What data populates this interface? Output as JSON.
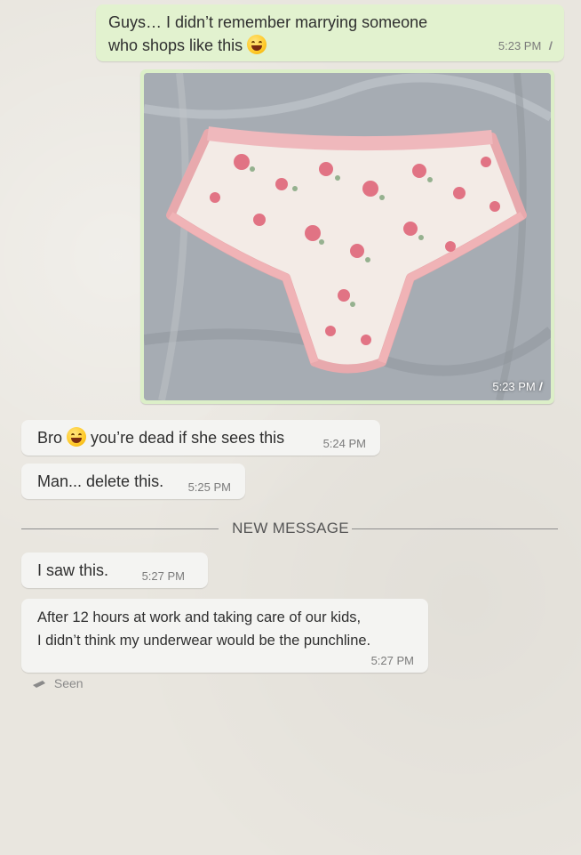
{
  "messages": [
    {
      "id": "m1",
      "dir": "out",
      "line1": "Guys… I didn’t remember marrying someone",
      "line2": "who shops like this",
      "emoji": "grinning-sweat-emoji",
      "time": "5:23 PM"
    },
    {
      "id": "m2",
      "dir": "out",
      "type": "image",
      "image_desc": "floral-underwear-photo",
      "time": "5:23 PM"
    },
    {
      "id": "m3",
      "dir": "in",
      "pre": "Bro",
      "emoji": "laughing-tears-emoji",
      "post": "you’re dead if she sees this",
      "time": "5:24 PM"
    },
    {
      "id": "m4",
      "dir": "in",
      "text": "Man... delete this.",
      "time": "5:25 PM"
    },
    {
      "id": "m5",
      "dir": "in",
      "text": "I saw this.",
      "time": "5:27 PM"
    },
    {
      "id": "m6",
      "dir": "in",
      "line1": "After 12 hours at work and taking care of our kids,",
      "line2": "I didn’t think my underwear would be the punchline.",
      "time": "5:27 PM"
    }
  ],
  "divider": {
    "label": "NEW MESSAGE"
  },
  "status": {
    "seen": "Seen",
    "icon": "seen-check-icon"
  },
  "colors": {
    "outgoing_bubble": "#e2f2cf",
    "incoming_bubble": "#f4f4f2",
    "background": "#e9e6df"
  }
}
